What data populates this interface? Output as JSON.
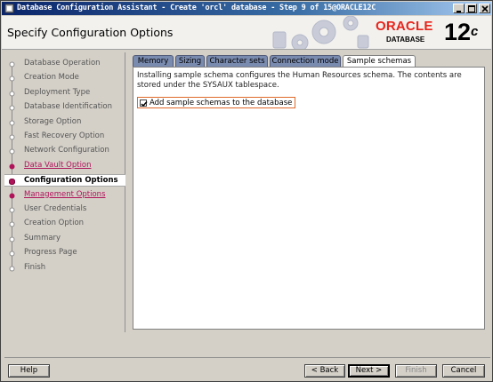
{
  "window": {
    "title": "Database Configuration Assistant - Create 'orcl' database - Step 9 of 15@ORACLE12C"
  },
  "header": {
    "heading": "Specify Configuration Options",
    "logo_text": "ORACLE",
    "logo_sub": "DATABASE",
    "version": "12",
    "version_suffix": "c"
  },
  "nav": {
    "items": [
      {
        "label": "Database Operation",
        "state": "done"
      },
      {
        "label": "Creation Mode",
        "state": "done"
      },
      {
        "label": "Deployment Type",
        "state": "done"
      },
      {
        "label": "Database Identification",
        "state": "done"
      },
      {
        "label": "Storage Option",
        "state": "done"
      },
      {
        "label": "Fast Recovery Option",
        "state": "done"
      },
      {
        "label": "Network Configuration",
        "state": "done"
      },
      {
        "label": "Data Vault Option",
        "state": "link"
      },
      {
        "label": "Configuration Options",
        "state": "active"
      },
      {
        "label": "Management Options",
        "state": "link"
      },
      {
        "label": "User Credentials",
        "state": "pending"
      },
      {
        "label": "Creation Option",
        "state": "pending"
      },
      {
        "label": "Summary",
        "state": "pending"
      },
      {
        "label": "Progress Page",
        "state": "pending"
      },
      {
        "label": "Finish",
        "state": "pending"
      }
    ]
  },
  "tabs": [
    {
      "label": "Memory",
      "selected": false
    },
    {
      "label": "Sizing",
      "selected": false
    },
    {
      "label": "Character sets",
      "selected": false
    },
    {
      "label": "Connection mode",
      "selected": false
    },
    {
      "label": "Sample schemas",
      "selected": true
    }
  ],
  "sample_schemas": {
    "description": "Installing sample schema configures the Human Resources schema. The contents are stored under the SYSAUX tablespace.",
    "checkbox_label": "Add sample schemas to the database",
    "checked": true
  },
  "buttons": {
    "help": "Help",
    "back": "< Back",
    "next": "Next >",
    "finish": "Finish",
    "cancel": "Cancel"
  },
  "colors": {
    "link": "#b0135a",
    "tab_inactive": "#7a8bb0",
    "accent_red": "#e8241b",
    "focus": "#e06a2a"
  }
}
